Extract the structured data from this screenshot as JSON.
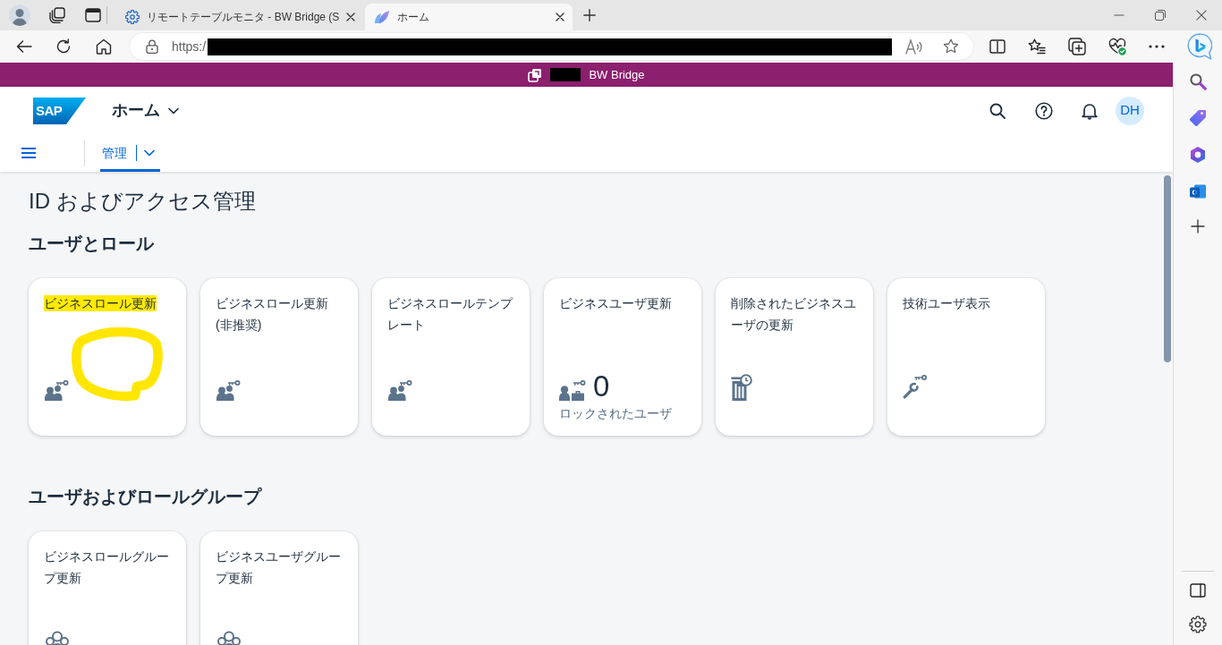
{
  "browser": {
    "tabs": [
      {
        "title": "リモートテーブルモニタ - BW Bridge (S",
        "selected": false
      },
      {
        "title": "ホーム",
        "selected": true
      }
    ],
    "address": {
      "url": "https:/",
      "redacted": true
    }
  },
  "shell_bar": {
    "title": "BW Bridge",
    "redacted": true
  },
  "header": {
    "logo": "SAP",
    "title": "ホーム",
    "avatar": "DH"
  },
  "nav": {
    "tabs": [
      {
        "label": "管理",
        "selected": true
      }
    ]
  },
  "page": {
    "title": "ID およびアクセス管理",
    "sections": [
      {
        "title": "ユーザとロール",
        "tiles": [
          {
            "title": "ビジネスロール更新",
            "highlighted": true,
            "circled": true
          },
          {
            "title": "ビジネスロール更新 (非推奨)",
            "highlighted": false,
            "circled": false
          },
          {
            "title": "ビジネスロールテンプレート",
            "highlighted": false,
            "circled": false
          },
          {
            "title": "ビジネスユーザ更新",
            "value": "0",
            "footer": "ロックされたユーザ",
            "highlighted": false,
            "circled": false
          },
          {
            "title": "削除されたビジネスユーザの更新",
            "highlighted": false,
            "circled": false
          },
          {
            "title": "技術ユーザ表示",
            "highlighted": false,
            "circled": false
          }
        ]
      },
      {
        "title": "ユーザおよびロールグループ",
        "tiles": [
          {
            "title": "ビジネスロールグループ更新",
            "highlighted": false,
            "circled": false
          },
          {
            "title": "ビジネスユーザグループ更新",
            "highlighted": false,
            "circled": false
          }
        ]
      }
    ]
  }
}
